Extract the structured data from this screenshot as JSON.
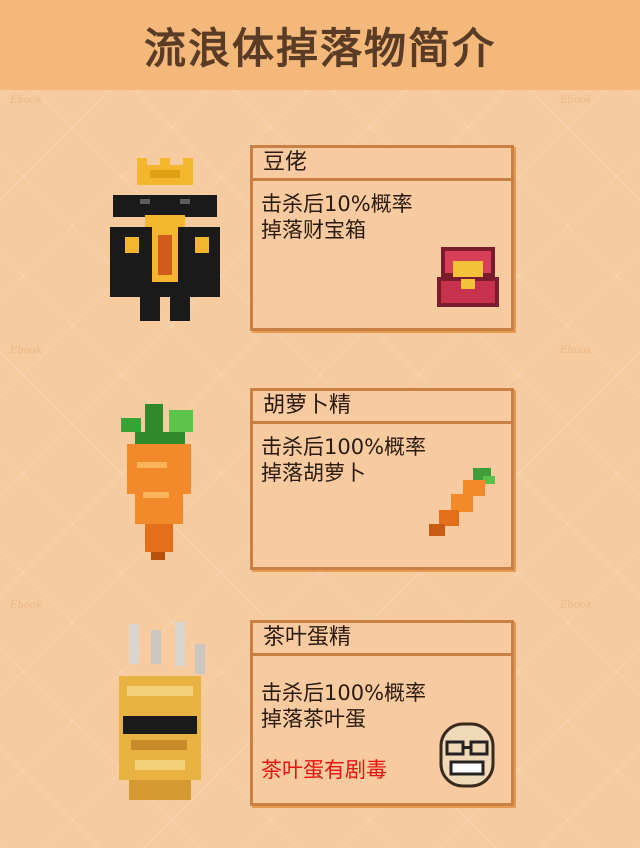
{
  "header": {
    "title": "流浪体掉落物简介"
  },
  "monsters": [
    {
      "name": "豆佬",
      "lines": [
        "击杀后10%概率",
        "掉落财宝箱"
      ],
      "drop_icon": "treasure-chest-icon",
      "portrait_icon": "bean-boss-sprite"
    },
    {
      "name": "胡萝卜精",
      "lines": [
        "击杀后100%概率",
        "掉落胡萝卜"
      ],
      "drop_icon": "carrot-icon",
      "portrait_icon": "carrot-spirit-sprite"
    },
    {
      "name": "茶叶蛋精",
      "lines": [
        "击杀后100%概率",
        "掉落茶叶蛋"
      ],
      "warning": "茶叶蛋有剧毒",
      "drop_icon": "grinning-egg-face-icon",
      "portrait_icon": "tea-egg-spirit-sprite"
    }
  ],
  "colors": {
    "background": "#f6cba0",
    "header": "#f4b97a",
    "card_border": "#c98044",
    "warning_text": "#e8130e"
  }
}
